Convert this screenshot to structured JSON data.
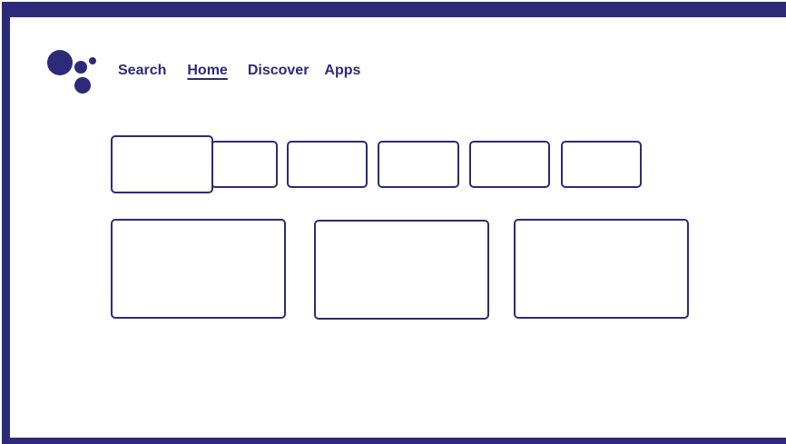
{
  "nav": {
    "tabs": [
      {
        "label": "Search",
        "active": false
      },
      {
        "label": "Home",
        "active": true
      },
      {
        "label": "Discover",
        "active": false
      },
      {
        "label": "Apps",
        "active": false
      }
    ]
  },
  "colors": {
    "brand": "#2d2a7a",
    "background": "#ffffff"
  },
  "icons": {
    "logo": "assistant-dots-icon"
  },
  "rows": {
    "small_tiles": 6,
    "large_cards": 3,
    "focused_tile_index": 0
  }
}
